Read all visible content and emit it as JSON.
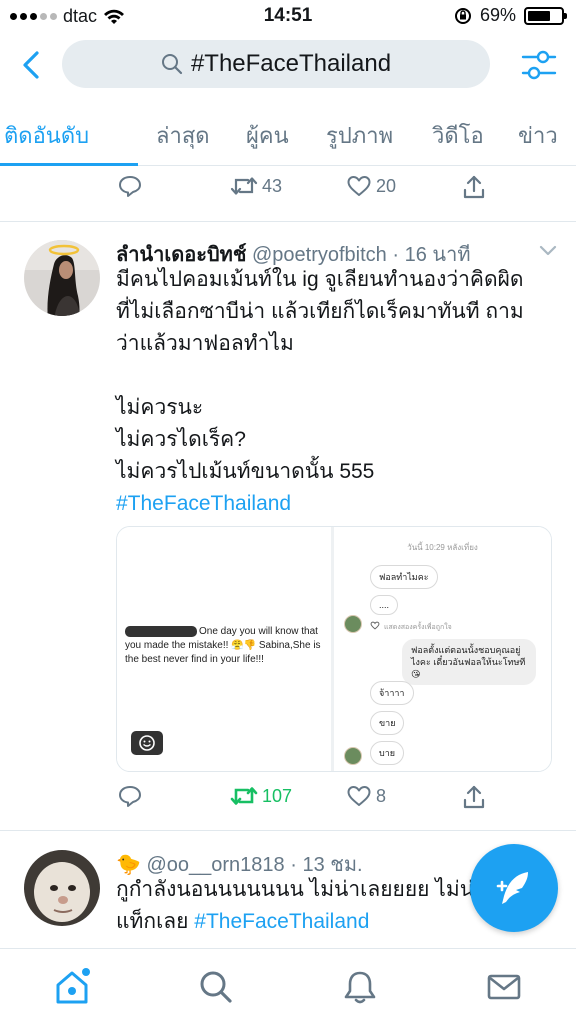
{
  "status_bar": {
    "carrier": "dtac",
    "time": "14:51",
    "battery_percent": "69%",
    "battery_level": 0.69,
    "signal_bars_on": 3,
    "signal_bars_total": 5
  },
  "header": {
    "search_query": "#TheFaceThailand"
  },
  "tabs": [
    {
      "label": "ติดอันดับ",
      "active": true
    },
    {
      "label": "ล่าสุด"
    },
    {
      "label": "ผู้คน"
    },
    {
      "label": "รูปภาพ"
    },
    {
      "label": "วิดีโอ"
    },
    {
      "label": "ข่าว"
    }
  ],
  "prev_tweet_actions": {
    "retweets": "43",
    "likes": "20"
  },
  "tweet1": {
    "name": "ลำนำเดอะบิทช์",
    "handle": "@poetryofbitch",
    "separator": "·",
    "time": "16 นาที",
    "text_lines": [
      "มีคนไปคอมเม้นท์ใน ig จูเลียนทำนองว่าคิดผิด",
      "ที่ไม่เลือกซาบีน่า แล้วเทียก็ไดเร็คมาทันที ถาม",
      "ว่าแล้วมาฟอลทำไม",
      "",
      "ไม่ควรนะ",
      "ไม่ควรไดเร็ค?",
      "ไม่ควรไปเม้นท์ขนาดนั้น 555"
    ],
    "hashtag": "#TheFaceThailand",
    "media": {
      "comment_text": "One day you will know that you made the mistake!! 😤👎 Sabina,She is the best never find in your life!!!",
      "chat_time": "วันนี้ 10:29 หลังเที่ยง",
      "bubble_1": "ฟอลทำไมคะ",
      "bubble_2": "....",
      "seen_text": "แสดงสองครั้งเพื่อถูกใจ",
      "bubble_me": "ฟอลตั้งแต่ตอนนั้งชอบคุณอยู่ไงคะ เดี๋ยวอันฟอลให้นะโทษที😘",
      "bubble_3": "จ้าาาา",
      "bubble_4": "ขาย",
      "bubble_5": "บาย"
    },
    "retweets": "107",
    "likes": "8"
  },
  "tweet2": {
    "emoji": "🐤",
    "handle": "@oo__orn1818",
    "separator": "·",
    "time": "13 ชม.",
    "text_line1": "กูกำลังนอนนนนนนน ไม่น่าเลยยยย ไม่น่",
    "text_line2_prefix": "แท็กเลย ",
    "hashtag": "#TheFaceThailand"
  },
  "colors": {
    "accent": "#1da1f2",
    "retweet_active": "#17bf63",
    "muted": "#657786"
  }
}
